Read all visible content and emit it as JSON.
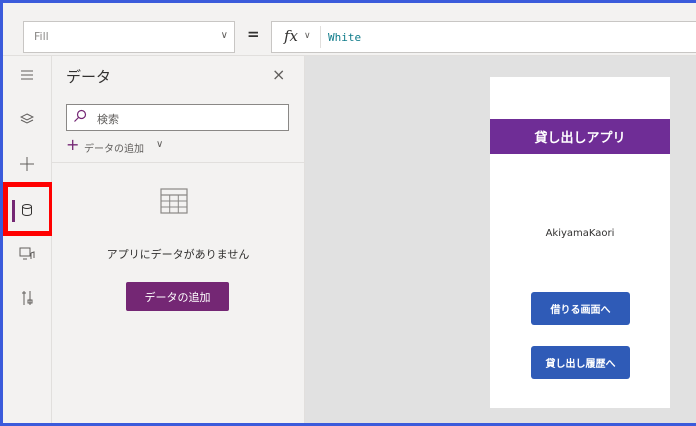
{
  "formula_bar": {
    "property": "Fill",
    "formula": "White",
    "fx_label": "fx",
    "equals": "="
  },
  "rail": {
    "items": [
      {
        "icon": "hamburger-icon"
      },
      {
        "icon": "layers-icon"
      },
      {
        "icon": "plus-icon"
      },
      {
        "icon": "database-icon",
        "active": true
      },
      {
        "icon": "media-icon"
      },
      {
        "icon": "tools-icon"
      }
    ]
  },
  "panel": {
    "title": "データ",
    "close": "×",
    "search_placeholder": "検索",
    "add_label": "データの追加",
    "empty_text": "アプリにデータがありません",
    "add_button": "データの追加"
  },
  "app_screen": {
    "header": "貸し出しアプリ",
    "user_name": "AkiyamaKaori",
    "button_borrow": "借りる画面へ",
    "button_history": "貸し出し履歴へ"
  },
  "colors": {
    "accent": "#742774",
    "header": "#6f2d96",
    "button": "#2f5bb7",
    "highlight": "#ff0000",
    "frame": "#3b5bdb"
  }
}
